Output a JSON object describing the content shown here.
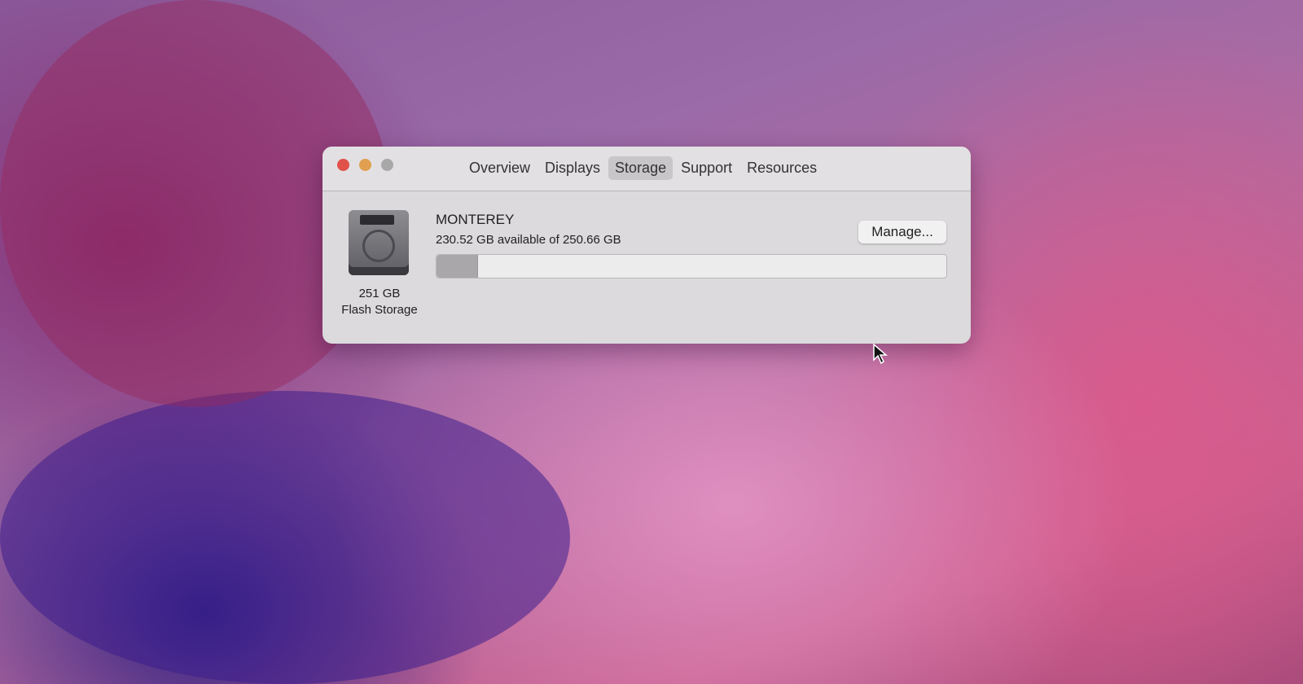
{
  "window": {
    "tabs": [
      {
        "label": "Overview"
      },
      {
        "label": "Displays"
      },
      {
        "label": "Storage"
      },
      {
        "label": "Support"
      },
      {
        "label": "Resources"
      }
    ],
    "active_tab": "Storage"
  },
  "storage": {
    "disk_size": "251 GB",
    "disk_type": "Flash Storage",
    "volume_name": "MONTEREY",
    "availability": "230.52 GB available of 250.66 GB",
    "used_fraction": 0.08,
    "manage_label": "Manage..."
  },
  "colors": {
    "close": "#e0524a",
    "minimize": "#e0a050",
    "zoom": "#a8a8a8"
  },
  "icons": {
    "disk": "hard-drive-icon",
    "cursor": "arrow-cursor-icon"
  }
}
